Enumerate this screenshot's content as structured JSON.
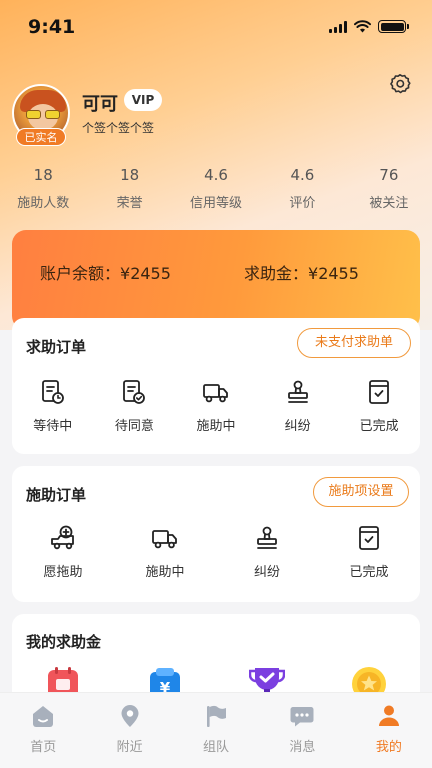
{
  "status_bar": {
    "time": "9:41"
  },
  "profile": {
    "name": "可可",
    "vip_label": "VIP",
    "verified_label": "已实名",
    "signature": "个签个签个签"
  },
  "stats": [
    {
      "value": "18",
      "label": "施助人数"
    },
    {
      "value": "18",
      "label": "荣誉"
    },
    {
      "value": "4.6",
      "label": "信用等级"
    },
    {
      "value": "4.6",
      "label": "评价"
    },
    {
      "value": "76",
      "label": "被关注"
    }
  ],
  "balance": {
    "account_label": "账户余额：",
    "account_value": "¥2455",
    "help_label": "求助金：",
    "help_value": "¥2455"
  },
  "help_orders": {
    "title": "求助订单",
    "action_label": "未支付求助单",
    "items": [
      {
        "label": "等待中",
        "icon": "clock-document-icon"
      },
      {
        "label": "待同意",
        "icon": "check-document-icon"
      },
      {
        "label": "施助中",
        "icon": "truck-icon"
      },
      {
        "label": "纠纷",
        "icon": "stamp-icon"
      },
      {
        "label": "已完成",
        "icon": "completed-box-icon"
      }
    ]
  },
  "assist_orders": {
    "title": "施助订单",
    "action_label": "施助项设置",
    "items": [
      {
        "label": "愿拖助",
        "icon": "tow-truck-plus-icon"
      },
      {
        "label": "施助中",
        "icon": "truck-icon"
      },
      {
        "label": "纠纷",
        "icon": "stamp-icon"
      },
      {
        "label": "已完成",
        "icon": "completed-box-icon"
      }
    ]
  },
  "help_fund": {
    "title": "我的求助金",
    "icons": [
      "calendar-icon",
      "yuan-wallet-icon",
      "trophy-icon",
      "gold-coin-icon"
    ]
  },
  "tab_bar": {
    "items": [
      {
        "label": "首页",
        "icon": "home-icon"
      },
      {
        "label": "附近",
        "icon": "location-pin-icon"
      },
      {
        "label": "组队",
        "icon": "flag-icon"
      },
      {
        "label": "消息",
        "icon": "chat-bubble-icon"
      },
      {
        "label": "我的",
        "icon": "person-icon"
      }
    ],
    "active": "我的"
  },
  "colors": {
    "accent": "#F07B25",
    "inactive_tab": "#A8B0BC"
  }
}
